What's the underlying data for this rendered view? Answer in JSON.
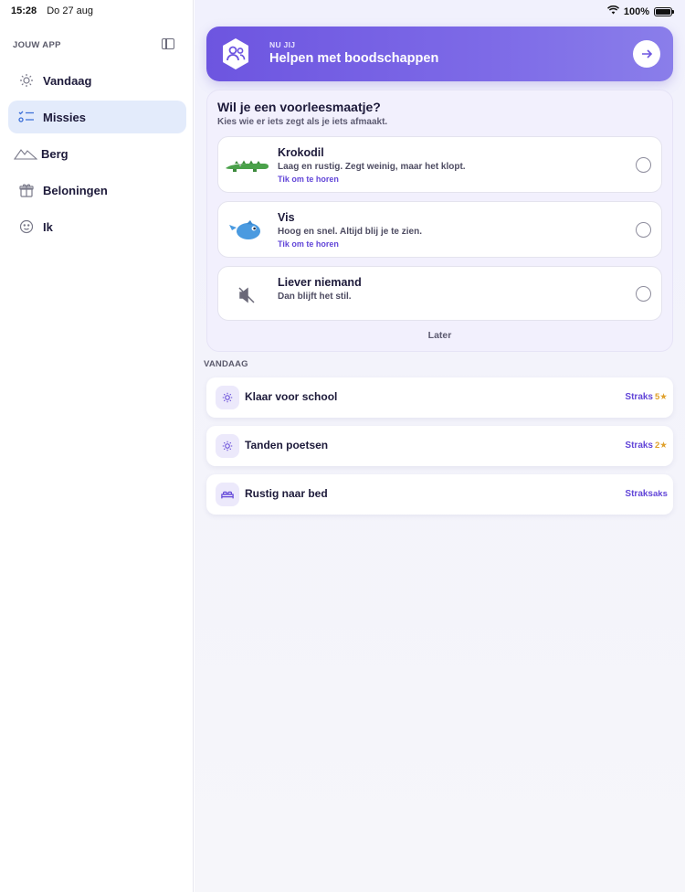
{
  "status_bar": {
    "time": "15:28",
    "date": "Do 27 aug",
    "battery": "100%"
  },
  "sidebar": {
    "header": "JOUW APP",
    "items": [
      {
        "label": "Vandaag",
        "icon": "sun-icon",
        "active": false
      },
      {
        "label": "Missies",
        "icon": "checklist-icon",
        "active": true
      },
      {
        "label": "Berg",
        "icon": "mountain-icon",
        "active": false
      },
      {
        "label": "Beloningen",
        "icon": "gift-icon",
        "active": false
      },
      {
        "label": "Ik",
        "icon": "smiley-icon",
        "active": false
      }
    ]
  },
  "banner": {
    "kicker": "NU JIJ",
    "title": "Helpen met boodschappen"
  },
  "prompt": {
    "title": "Wil je een voorleesmaatje?",
    "subtitle": "Kies wie er iets zegt als je iets afmaakt.",
    "options": [
      {
        "title": "Krokodil",
        "desc": "Laag en rustig. Zegt weinig, maar het klopt.",
        "link": "Tik om te horen",
        "icon": "crocodile-icon"
      },
      {
        "title": "Vis",
        "desc": "Hoog en snel. Altijd blij je te zien.",
        "link": "Tik om te horen",
        "icon": "fish-icon"
      },
      {
        "title": "Liever niemand",
        "desc": "Dan blijft het stil.",
        "link": "",
        "icon": "mute-icon"
      }
    ],
    "later": "Later"
  },
  "today": {
    "label": "VANDAAG",
    "tasks": [
      {
        "title": "Klaar voor school",
        "status": "Straks",
        "points": "5★",
        "icon": "sun-icon"
      },
      {
        "title": "Tanden poetsen",
        "status": "Straks",
        "points": "2★",
        "icon": "sun-icon"
      },
      {
        "title": "Rustig naar bed",
        "status": "Straks",
        "points": "aks",
        "icon": "bed-icon"
      }
    ]
  },
  "colors": {
    "accent": "#6246d8",
    "banner": "#7560e4",
    "active_nav": "#e3ebfb",
    "star": "#e0a12c"
  }
}
